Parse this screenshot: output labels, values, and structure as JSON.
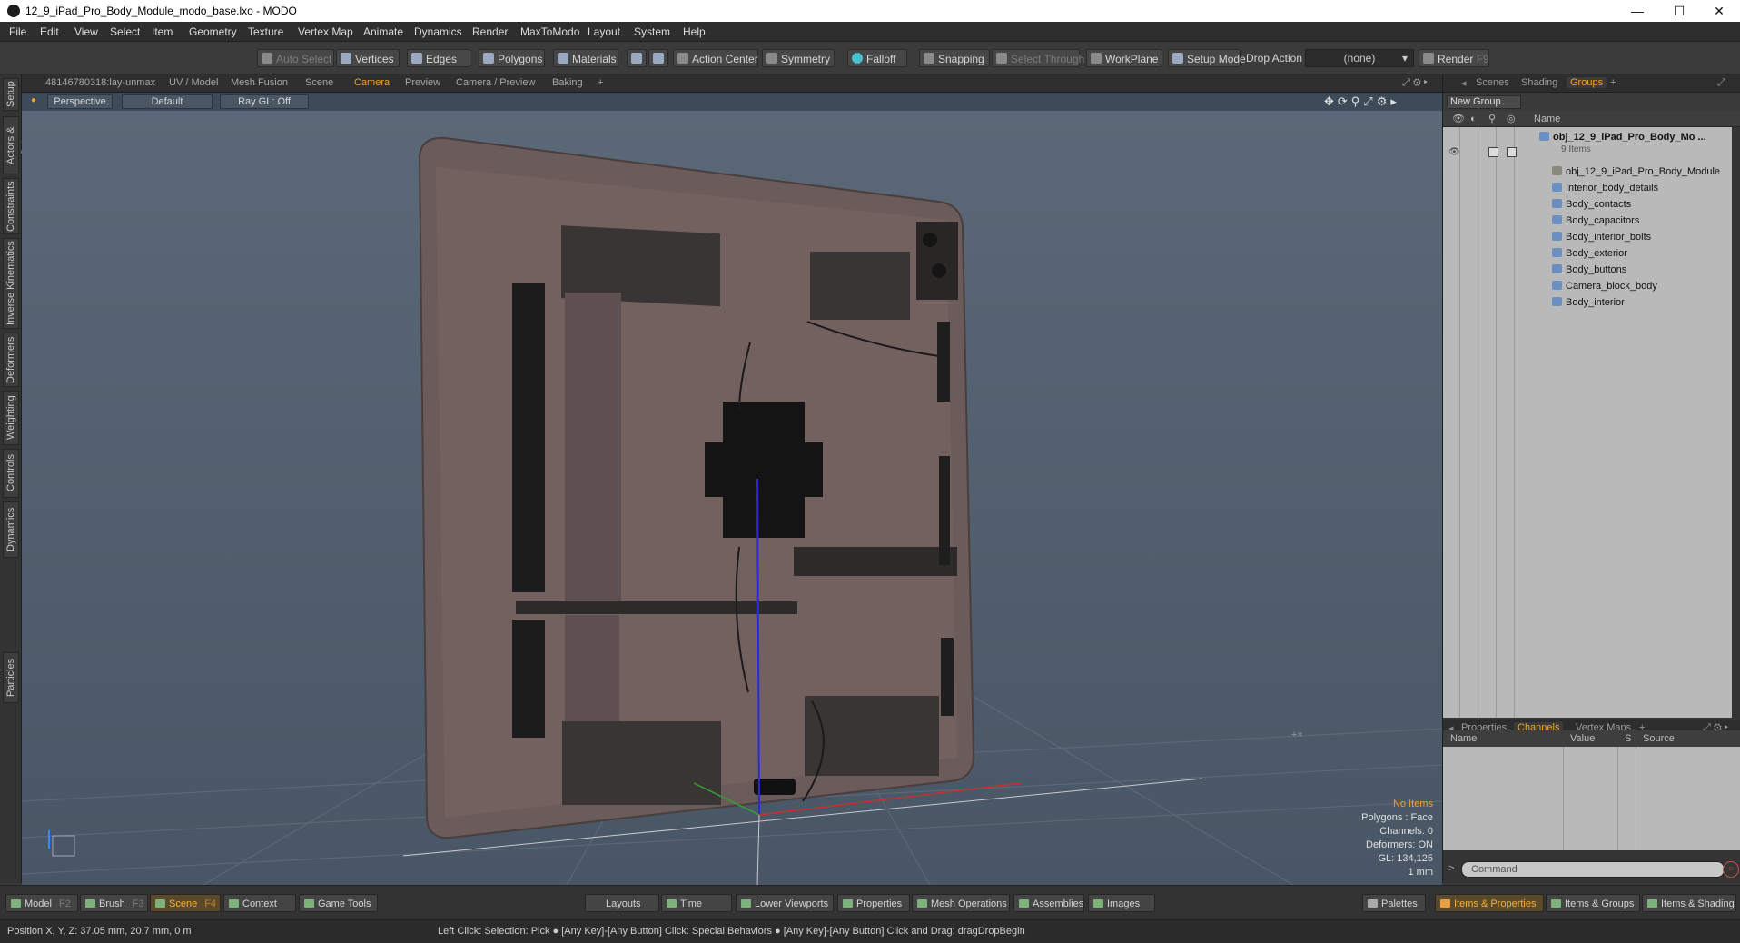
{
  "window": {
    "title": "12_9_iPad_Pro_Body_Module_modo_base.lxo - MODO",
    "minimize": "—",
    "maximize": "☐",
    "close": "✕"
  },
  "menu": [
    "File",
    "Edit",
    "View",
    "Select",
    "Item",
    "Geometry",
    "Texture",
    "Vertex Map",
    "Animate",
    "Dynamics",
    "Render",
    "MaxToModo",
    "Layout",
    "System",
    "Help"
  ],
  "toolbar": {
    "auto_select": "Auto Select",
    "vertices": "Vertices",
    "edges": "Edges",
    "polygons": "Polygons",
    "materials": "Materials",
    "action_center": "Action Center",
    "symmetry": "Symmetry",
    "falloff": "Falloff",
    "snapping": "Snapping",
    "select_through": "Select Through",
    "workplane": "WorkPlane",
    "setup_mode": "Setup Mode",
    "drop_action": "Drop Action",
    "drop_value": "(none)",
    "render": "Render",
    "render_key": "F9"
  },
  "left_tabs": [
    "Setup",
    "Actors & Sets",
    "Constraints",
    "Inverse Kinematics",
    "Deformers",
    "Weighting",
    "Controls",
    "Dynamics",
    "Particles"
  ],
  "view_tabs": [
    "48146780318:lay-unmax",
    "UV / Model",
    "Mesh Fusion",
    "Scene",
    "Camera",
    "Preview",
    "Camera / Preview",
    "Baking",
    "+"
  ],
  "viewport": {
    "projection": "Perspective",
    "shading": "Default",
    "raygl": "Ray GL: Off",
    "info": {
      "items": "No Items",
      "polygons": "Polygons : Face",
      "channels": "Channels: 0",
      "deformers": "Deformers: ON",
      "gl": "GL: 134,125",
      "scale": "1 mm"
    }
  },
  "right_panel": {
    "tabs": [
      "Scenes",
      "Shading",
      "Groups",
      "+"
    ],
    "new_group": "New Group",
    "name_header": "Name",
    "root": {
      "name": "obj_12_9_iPad_Pro_Body_Mo ...",
      "count": "9 Items"
    },
    "items": [
      "obj_12_9_iPad_Pro_Body_Module",
      "Interior_body_details",
      "Body_contacts",
      "Body_capacitors",
      "Body_interior_bolts",
      "Body_exterior",
      "Body_buttons",
      "Camera_block_body",
      "Body_interior"
    ],
    "lower_tabs": [
      "Properties",
      "Channels",
      "Vertex Maps",
      "+"
    ],
    "channel_headers": {
      "name": "Name",
      "value": "Value",
      "s": "S",
      "source": "Source"
    },
    "command_placeholder": "Command"
  },
  "bottom": {
    "model": "Model",
    "model_key": "F2",
    "brush": "Brush",
    "brush_key": "F3",
    "scene": "Scene",
    "scene_key": "F4",
    "context": "Context",
    "game_tools": "Game Tools",
    "layouts": "Layouts",
    "time": "Time",
    "lower_viewports": "Lower Viewports",
    "properties": "Properties",
    "mesh_operations": "Mesh Operations",
    "assemblies": "Assemblies",
    "images": "Images",
    "palettes": "Palettes",
    "items_properties": "Items & Properties",
    "items_groups": "Items & Groups",
    "items_shading": "Items & Shading"
  },
  "status": {
    "position": "Position X, Y, Z:  37.05 mm, 20.7 mm, 0 m",
    "hint": "Left Click: Selection: Pick ● [Any Key]-[Any Button] Click: Special Behaviors ● [Any Key]-[Any Button] Click and Drag: dragDropBegin"
  },
  "colors": {
    "accent": "#f0a030",
    "viewport_top": "#5a6877",
    "tree_bg": "#b9b9b9"
  }
}
